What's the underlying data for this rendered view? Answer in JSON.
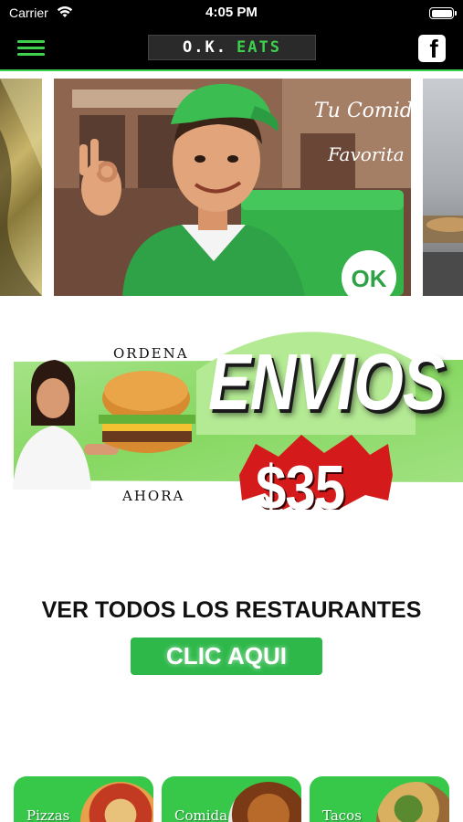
{
  "status_bar": {
    "carrier": "Carrier",
    "time": "4:05 PM"
  },
  "nav": {
    "logo_ok": "O.K.",
    "logo_eats": "EATS",
    "facebook_glyph": "f"
  },
  "carousel": {
    "main_slide_script": [
      "Tu Comida",
      "Favorita"
    ],
    "bag_badge": "OK"
  },
  "promo": {
    "ordena": "ORDENA",
    "ahora": "AHORA",
    "envios": "ENVIOS",
    "price": "$35"
  },
  "restaurants": {
    "title": "VER TODOS LOS RESTAURANTES",
    "button_label": "CLIC AQUI"
  },
  "categories": [
    {
      "label": "Pizzas",
      "icon": "pizza-image"
    },
    {
      "label": "Comida",
      "icon": "noodles-image"
    },
    {
      "label": "Tacos",
      "icon": "tacos-image"
    }
  ],
  "colors": {
    "brand_green": "#3ed14e",
    "button_green": "#2eb84a",
    "price_red": "#d41a1a",
    "header_bg": "#000000"
  }
}
